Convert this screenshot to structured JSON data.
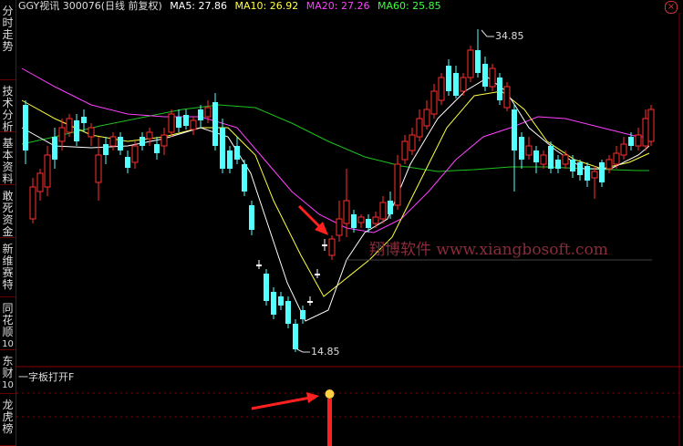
{
  "sidebar": {
    "tabs": [
      {
        "label": "分时走势",
        "active": false
      },
      {
        "label": "技术分析",
        "active": false
      },
      {
        "label": "基本资料",
        "active": false
      },
      {
        "label": "敢死资金",
        "active": false
      },
      {
        "label": "新维赛特",
        "active": false
      },
      {
        "label": "同花顺10",
        "active": false
      },
      {
        "label": "东财10",
        "active": false
      },
      {
        "label": "龙虎榜",
        "active": false
      }
    ]
  },
  "header": {
    "stock": "GGY视讯 300076(日线 前复权)",
    "ma5": "MA5: 27.86",
    "ma10": "MA10: 26.92",
    "ma20": "MA20: 27.26",
    "ma60": "MA60: 25.85",
    "close_icon": "close-icon"
  },
  "chart": {
    "high_label": "34.85",
    "low_label": "14.85",
    "watermark": "翔博软件 www.xiangbosoft.com",
    "indicator_label": "一字板打开F",
    "colors": {
      "up": "#ff3030",
      "down": "#54ffff",
      "ma5": "#ffffff",
      "ma10": "#ffff40",
      "ma20": "#ff40ff",
      "ma60": "#20c020",
      "arrow": "#ff2020"
    }
  }
}
